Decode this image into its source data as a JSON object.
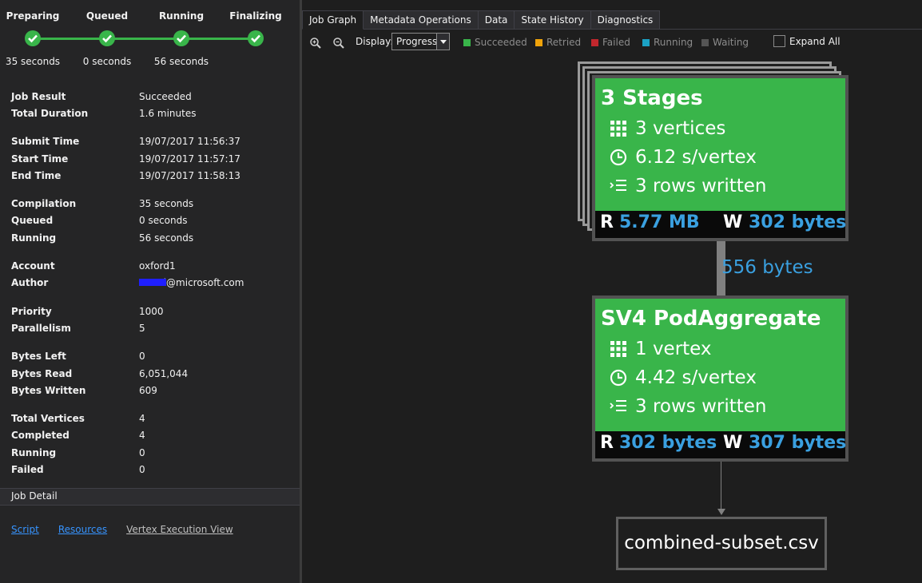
{
  "steps": [
    {
      "name": "Preparing",
      "time": "35 seconds"
    },
    {
      "name": "Queued",
      "time": "0 seconds"
    },
    {
      "name": "Running",
      "time": "56 seconds"
    },
    {
      "name": "Finalizing",
      "time": ""
    }
  ],
  "props": {
    "job_result_label": "Job Result",
    "job_result": "Succeeded",
    "total_duration_label": "Total Duration",
    "total_duration": "1.6 minutes",
    "submit_time_label": "Submit Time",
    "submit_time": "19/07/2017 11:56:37",
    "start_time_label": "Start Time",
    "start_time": "19/07/2017 11:57:17",
    "end_time_label": "End Time",
    "end_time": "19/07/2017 11:58:13",
    "compilation_label": "Compilation",
    "compilation": "35 seconds",
    "queued_label": "Queued",
    "queued": "0 seconds",
    "running_label": "Running",
    "running": "56 seconds",
    "account_label": "Account",
    "account": "oxford1",
    "author_label": "Author",
    "author": "a     d@microsoft.com",
    "priority_label": "Priority",
    "priority": "1000",
    "parallelism_label": "Parallelism",
    "parallelism": "5",
    "bytes_left_label": "Bytes Left",
    "bytes_left": "0",
    "bytes_read_label": "Bytes Read",
    "bytes_read": "6,051,044",
    "bytes_written_label": "Bytes Written",
    "bytes_written": "609",
    "total_vertices_label": "Total Vertices",
    "total_vertices": "4",
    "completed_label": "Completed",
    "completed": "4",
    "running_v_label": "Running",
    "running_v": "0",
    "failed_label": "Failed",
    "failed": "0"
  },
  "job_detail": "Job Detail",
  "links": {
    "script": "Script",
    "resources": "Resources",
    "vertex_view": "Vertex Execution View"
  },
  "tabs": [
    "Job Graph",
    "Metadata Operations",
    "Data",
    "State History",
    "Diagnostics"
  ],
  "toolbar": {
    "display_label": "Display:",
    "display_value": "Progress",
    "expand_all": "Expand All",
    "legend": [
      {
        "label": "Succeeded",
        "color": "#39b54a"
      },
      {
        "label": "Retried",
        "color": "#f0a30a"
      },
      {
        "label": "Failed",
        "color": "#c1272d"
      },
      {
        "label": "Running",
        "color": "#1ba1c4"
      },
      {
        "label": "Waiting",
        "color": "#555555"
      }
    ]
  },
  "graph": {
    "stage1": {
      "title": "3 Stages",
      "vertices": "3 vertices",
      "time": "6.12 s/vertex",
      "rows": "3 rows written",
      "read_key": "R",
      "read": "5.77 MB",
      "write_key": "W",
      "write": "302 bytes"
    },
    "edge_label": "556 bytes",
    "stage2": {
      "title": "SV4 PodAggregate",
      "vertices": "1 vertex",
      "time": "4.42 s/vertex",
      "rows": "3 rows written",
      "read_key": "R",
      "read": "302 bytes",
      "write_key": "W",
      "write": "307 bytes"
    },
    "output": "combined-subset.csv"
  },
  "colors": {
    "success": "#39b54a",
    "link": "#3794ff",
    "bytes": "#3aa0e0"
  }
}
